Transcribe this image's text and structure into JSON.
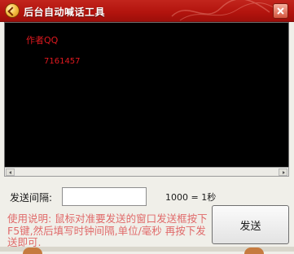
{
  "window": {
    "title": "后台自动喊话工具"
  },
  "log": {
    "lines": [
      "作者QQ",
      "7161457"
    ]
  },
  "form": {
    "interval_label": "发送间隔:",
    "interval_value": "",
    "unit_note": "1000 = 1秒"
  },
  "instructions": "使用说明: 鼠标对准要发送的窗口发送框按下F5键,然后填写时钟间隔,单位/毫秒 再按下发送即可.",
  "buttons": {
    "send_label": "发送"
  },
  "colors": {
    "titlebar": "#b3140e",
    "log_text": "#e0191f",
    "instructions_text": "#e06a6a"
  },
  "icons": {
    "app": "app-orb-icon",
    "close": "close-icon"
  }
}
